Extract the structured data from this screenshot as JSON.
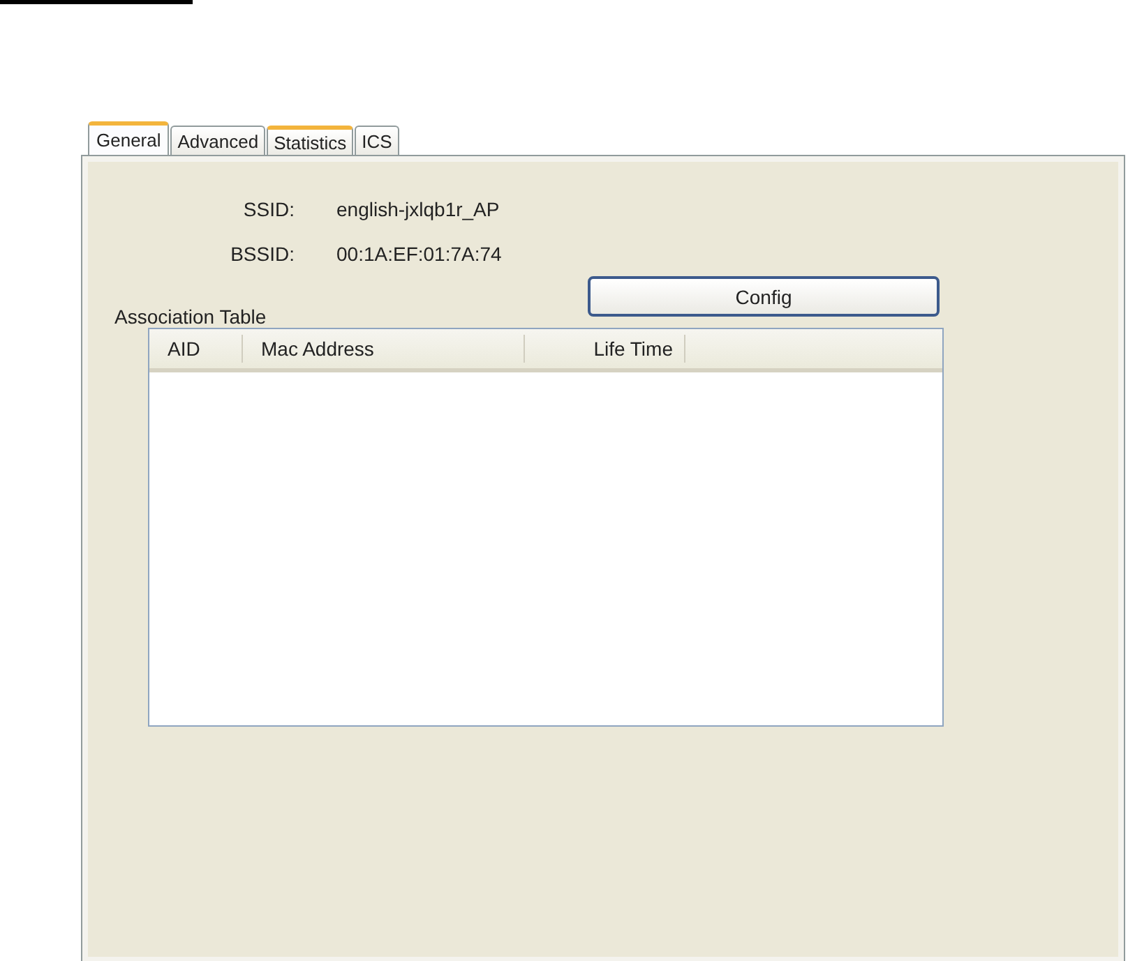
{
  "tabs": [
    {
      "label": "General",
      "selected": true,
      "hot": false
    },
    {
      "label": "Advanced",
      "selected": false,
      "hot": false
    },
    {
      "label": "Statistics",
      "selected": false,
      "hot": true
    },
    {
      "label": "ICS",
      "selected": false,
      "hot": false
    }
  ],
  "fields": [
    {
      "label": "SSID:",
      "value": "english-jxlqb1r_AP"
    },
    {
      "label": "BSSID:",
      "value": "00:1A:EF:01:7A:74"
    }
  ],
  "association_table": {
    "title": "Association Table",
    "columns": [
      "AID",
      "Mac Address",
      "Life Time"
    ]
  },
  "buttons": [
    "Config"
  ]
}
